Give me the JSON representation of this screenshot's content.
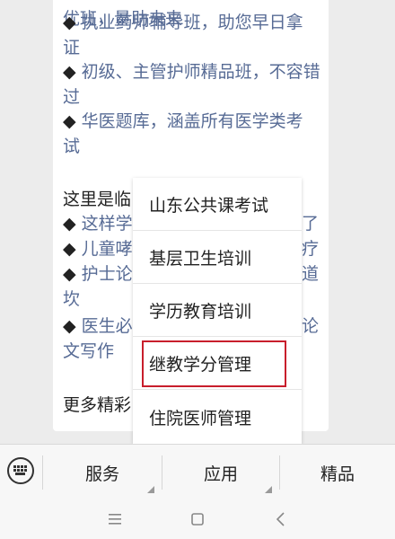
{
  "message": {
    "lines": [
      {
        "bullet": "",
        "text": "优班，量助未来"
      },
      {
        "bullet": "◆ ",
        "text": "执业药师辅导班，助您早日拿"
      },
      {
        "bullet": "",
        "text": "证"
      },
      {
        "bullet": "◆ ",
        "text": "初级、主管护师精品班，不容错"
      },
      {
        "bullet": "",
        "text": "过"
      },
      {
        "bullet": "◆ ",
        "text": "华医题库，涵盖所有医学类考"
      },
      {
        "bullet": "",
        "text": "试"
      },
      {
        "bullet": "",
        "text": ""
      },
      {
        "bullet": "",
        "text": "这里是临"
      },
      {
        "bullet": "◆ ",
        "text": "这样学"
      },
      {
        "bullet": "◆ ",
        "text": "儿童哮"
      },
      {
        "bullet": "◆ ",
        "text": "护士论"
      },
      {
        "bullet": "",
        "text": "坎"
      },
      {
        "bullet": "◆ ",
        "text": "医生必"
      },
      {
        "bullet": "",
        "text": "文写作"
      },
      {
        "bullet": "",
        "text": ""
      },
      {
        "bullet": "",
        "text": "更多精彩"
      }
    ],
    "overflow_right": [
      "了",
      "疗",
      "道",
      "论"
    ]
  },
  "popup_menu": {
    "items": [
      "山东公共课考试",
      "基层卫生培训",
      "学历教育培训",
      "继教学分管理",
      "住院医师管理"
    ],
    "highlighted_index": 3,
    "highlight_color": "#c81e2c"
  },
  "bottom_bar": {
    "tabs": [
      "服务",
      "应用",
      "精品"
    ]
  },
  "system_nav": {
    "menu_glyph": "☰",
    "home_glyph": "□",
    "back_glyph": "<"
  },
  "colors": {
    "link": "#576b95",
    "text": "#222222",
    "background": "#ececec"
  }
}
